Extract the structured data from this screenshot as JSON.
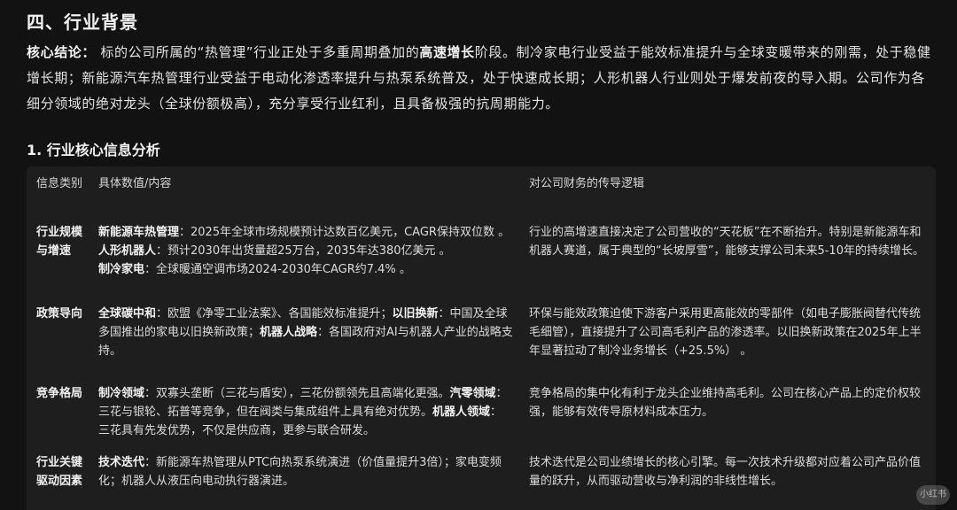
{
  "section": {
    "title": "四、行业背景"
  },
  "summary": {
    "label": "核心结论：",
    "part1": "标的公司所属的“热管理”行业正处于多重周期叠加的",
    "highlight": "高速增长",
    "part2": "阶段。制冷家电行业受益于能效标准提升与全球变暖带来的刚需，处于稳健增长期；新能源汽车热管理行业受益于电动化渗透率提升与热泵系统普及，处于快速成长期；人形机器人行业则处于爆发前夜的导入期。公司作为各细分领域的绝对龙头（全球份额极高），充分享受行业红利，且具备极强的抗周期能力。"
  },
  "subsection": {
    "title": "1. 行业核心信息分析"
  },
  "table": {
    "headers": {
      "col1": "信息类别",
      "col2": "具体数值/内容",
      "col3": "对公司财务的传导逻辑"
    },
    "rows": [
      {
        "label": "行业规模与增速",
        "items": [
          {
            "key": "新能源车热管理",
            "text": "：2025年全球市场规模预计达数百亿美元，CAGR保持双位数 。"
          },
          {
            "key": "人形机器人",
            "text": "：预计2030年出货量超25万台，2035年达380亿美元 。"
          },
          {
            "key": "制冷家电",
            "text": "：全球暖通空调市场2024-2030年CAGR约7.4% 。"
          }
        ],
        "logic": "行业的高增速直接决定了公司营收的“天花板”在不断抬升。特别是新能源车和机器人赛道，属于典型的“长坡厚雪”，能够支撑公司未来5-10年的持续增长。"
      },
      {
        "label": "政策导向",
        "items": [
          {
            "key": "全球碳中和",
            "text": "：欧盟《净零工业法案》、各国能效标准提升；"
          },
          {
            "key": "以旧换新",
            "text": "：中国及全球多国推出的家电以旧换新政策；"
          },
          {
            "key": "机器人战略",
            "text": "：各国政府对AI与机器人产业的战略支持。"
          }
        ],
        "logic": "环保与能效政策迫使下游客户采用更高能效的零部件（如电子膨胀阀替代传统毛细管），直接提升了公司高毛利产品的渗透率。以旧换新政策在2025年上半年显著拉动了制冷业务增长（+25.5%） 。"
      },
      {
        "label": "竞争格局",
        "items": [
          {
            "key": "制冷领域",
            "text": "：双寡头垄断（三花与盾安），三花份额领先且高端化更强。"
          },
          {
            "key": "汽零领域",
            "text": "：三花与银轮、拓普等竞争，但在阀类与集成组件上具有绝对优势。"
          },
          {
            "key": "机器人领域",
            "text": "：三花具有先发优势，不仅是供应商，更参与联合研发。"
          }
        ],
        "logic": "竞争格局的集中化有利于龙头企业维持高毛利。公司在核心产品上的定价权较强，能够有效传导原材料成本压力。"
      },
      {
        "label": "行业关键驱动因素",
        "items": [
          {
            "key": "技术迭代",
            "text": "：新能源车热管理从PTC向热泵系统演进（价值量提升3倍）；家电变频化；机器人从液压向电动执行器演进。"
          }
        ],
        "logic": "技术迭代是公司业绩增长的核心引擎。每一次技术升级都对应着公司产品价值量的跃升，从而驱动营收与净利润的非线性增长。"
      }
    ]
  },
  "watermark": {
    "text": "小红书"
  }
}
